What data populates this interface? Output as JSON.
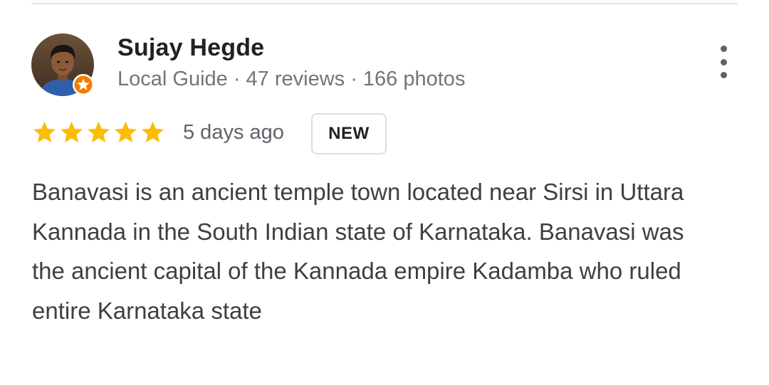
{
  "review": {
    "reviewer_name": "Sujay Hegde",
    "reviewer_meta": "Local Guide · 47 reviews · 166 photos",
    "rating": 5,
    "rating_max": 5,
    "date": "5 days ago",
    "badge": "NEW",
    "text": "Banavasi is an ancient temple town located near Sirsi in Uttara Kannada in the South Indian state of Karnataka. Banavasi was the ancient capital of the Kannada empire Kadamba who ruled entire Karnataka state"
  },
  "icons": {
    "avatar": "reviewer-photo",
    "guide_badge": "local-guide-star-icon",
    "more": "more-vertical-icon",
    "star": "star-icon"
  },
  "colors": {
    "star": "#fbbc04",
    "guide_badge": "#f57c00",
    "name": "#202124",
    "meta": "#70757a",
    "body": "#3c4043"
  }
}
